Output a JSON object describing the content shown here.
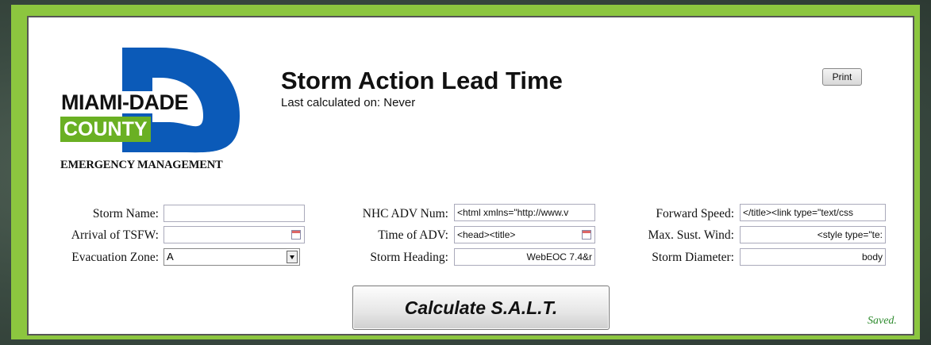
{
  "logo": {
    "line1": "MIAMI-DADE",
    "line2": "COUNTY",
    "line3": "EMERGENCY MANAGEMENT",
    "colors": {
      "blue": "#0b5ab8",
      "green": "#6ab023"
    }
  },
  "header": {
    "title": "Storm Action Lead Time",
    "subtitle": "Last calculated on: Never",
    "print_label": "Print"
  },
  "form": {
    "storm_name": {
      "label": "Storm Name:",
      "value": ""
    },
    "arrival_tsfw": {
      "label": "Arrival of TSFW:",
      "value": ""
    },
    "evacuation_zone": {
      "label": "Evacuation Zone:",
      "value": "A"
    },
    "nhc_adv_num": {
      "label": "NHC ADV Num:",
      "value": "<html xmlns=\"http://www.v"
    },
    "time_of_adv": {
      "label": "Time of ADV:",
      "value": "<head><title>"
    },
    "storm_heading": {
      "label": "Storm Heading:",
      "value": "WebEOC 7.4&r"
    },
    "forward_speed": {
      "label": "Forward Speed:",
      "value": "</title><link type=\"text/css"
    },
    "max_sust_wind": {
      "label": "Max. Sust. Wind:",
      "value": "<style type=\"te:"
    },
    "storm_diameter": {
      "label": "Storm Diameter:",
      "value": "body"
    }
  },
  "actions": {
    "calculate_label": "Calculate S.A.L.T.",
    "status": "Saved."
  }
}
